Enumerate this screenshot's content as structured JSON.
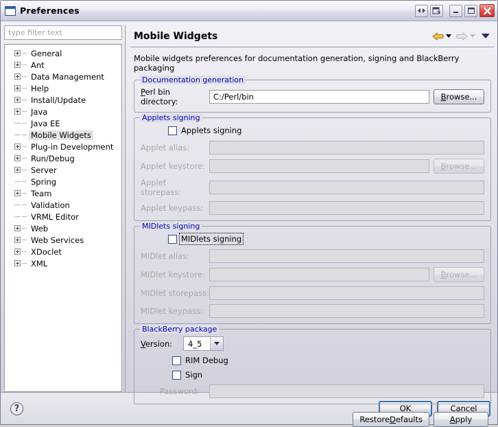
{
  "window": {
    "title": "Preferences",
    "icon": "window-icon",
    "buttons": [
      {
        "name": "restore-dock-button",
        "glyph": "◀▶"
      },
      {
        "name": "detach-button",
        "glyph": "❐"
      },
      {
        "name": "minimize-button",
        "glyph": "–"
      },
      {
        "name": "maximize-button",
        "glyph": "□"
      },
      {
        "name": "close-button",
        "glyph": "✕"
      }
    ]
  },
  "sidebar": {
    "filter": {
      "placeholder": "type filter text",
      "value": ""
    },
    "items": [
      {
        "label": "General",
        "expandable": true,
        "selected": false
      },
      {
        "label": "Ant",
        "expandable": true,
        "selected": false
      },
      {
        "label": "Data Management",
        "expandable": true,
        "selected": false
      },
      {
        "label": "Help",
        "expandable": true,
        "selected": false
      },
      {
        "label": "Install/Update",
        "expandable": true,
        "selected": false
      },
      {
        "label": "Java",
        "expandable": true,
        "selected": false
      },
      {
        "label": "Java EE",
        "expandable": false,
        "selected": false
      },
      {
        "label": "Mobile Widgets",
        "expandable": false,
        "selected": true
      },
      {
        "label": "Plug-in Development",
        "expandable": true,
        "selected": false
      },
      {
        "label": "Run/Debug",
        "expandable": true,
        "selected": false
      },
      {
        "label": "Server",
        "expandable": true,
        "selected": false
      },
      {
        "label": "Spring",
        "expandable": false,
        "selected": false
      },
      {
        "label": "Team",
        "expandable": true,
        "selected": false
      },
      {
        "label": "Validation",
        "expandable": false,
        "selected": false
      },
      {
        "label": "VRML Editor",
        "expandable": false,
        "selected": false
      },
      {
        "label": "Web",
        "expandable": true,
        "selected": false
      },
      {
        "label": "Web Services",
        "expandable": true,
        "selected": false
      },
      {
        "label": "XDoclet",
        "expandable": true,
        "selected": false
      },
      {
        "label": "XML",
        "expandable": true,
        "selected": false
      }
    ]
  },
  "page": {
    "title": "Mobile Widgets",
    "description": "Mobile widgets preferences for documentation generation, signing and BlackBerry packaging",
    "nav": {
      "back_icon": "back-arrow-icon",
      "back_menu_icon": "back-dropdown-icon",
      "forward_icon": "forward-arrow-icon",
      "forward_menu_icon": "forward-dropdown-icon",
      "menu_icon": "view-menu-icon"
    }
  },
  "doc_group": {
    "legend": "Documentation generation",
    "perl_label_pre": "P",
    "perl_label_post": "erl bin directory:",
    "perl_value": "C:/Perl/bin",
    "browse_label": "Browse...",
    "browse_label_pre": "B",
    "browse_label_post": "rowse..."
  },
  "applets_group": {
    "legend": "Applets signing",
    "checkbox_label": "Applets signing",
    "checkbox_checked": false,
    "fields": [
      {
        "label": "Applet alias:",
        "value": "",
        "browse": false
      },
      {
        "label": "Applet keystore:",
        "value": "",
        "browse": true
      },
      {
        "label": "Applet storepass:",
        "value": "",
        "browse": false
      },
      {
        "label": "Applet keypass:",
        "value": "",
        "browse": false
      }
    ],
    "browse_label_pre": "B",
    "browse_label_post": "rowse..."
  },
  "midlets_group": {
    "legend": "MIDlets signing",
    "checkbox_label": "MIDlets signing",
    "checkbox_checked": false,
    "checkbox_focused": true,
    "fields": [
      {
        "label": "MIDlet alias:",
        "value": "",
        "browse": false
      },
      {
        "label": "MIDlet keystore:",
        "value": "",
        "browse": true
      },
      {
        "label": "MIDlet storepass:",
        "value": "",
        "browse": false
      },
      {
        "label": "MIDlet keypass:",
        "value": "",
        "browse": false
      }
    ],
    "browse_label_pre": "B",
    "browse_label_post": "rowse..."
  },
  "blackberry_group": {
    "legend": "BlackBerry package",
    "version_label_pre": "V",
    "version_label_post": "ersion:",
    "version_value": "4_5",
    "version_options": [
      "4_5"
    ],
    "rim_debug_label": "RIM Debug",
    "rim_debug_checked": false,
    "sign_label": "Sign",
    "sign_checked": false,
    "password_label": "Password:",
    "password_value": ""
  },
  "actions": {
    "restore_pre": "Restore ",
    "restore_mnemonic": "D",
    "restore_post": "efaults",
    "apply_mnemonic": "A",
    "apply_post": "pply"
  },
  "footer": {
    "help_glyph": "?",
    "ok_label": "OK",
    "cancel_label": "Cancel"
  }
}
